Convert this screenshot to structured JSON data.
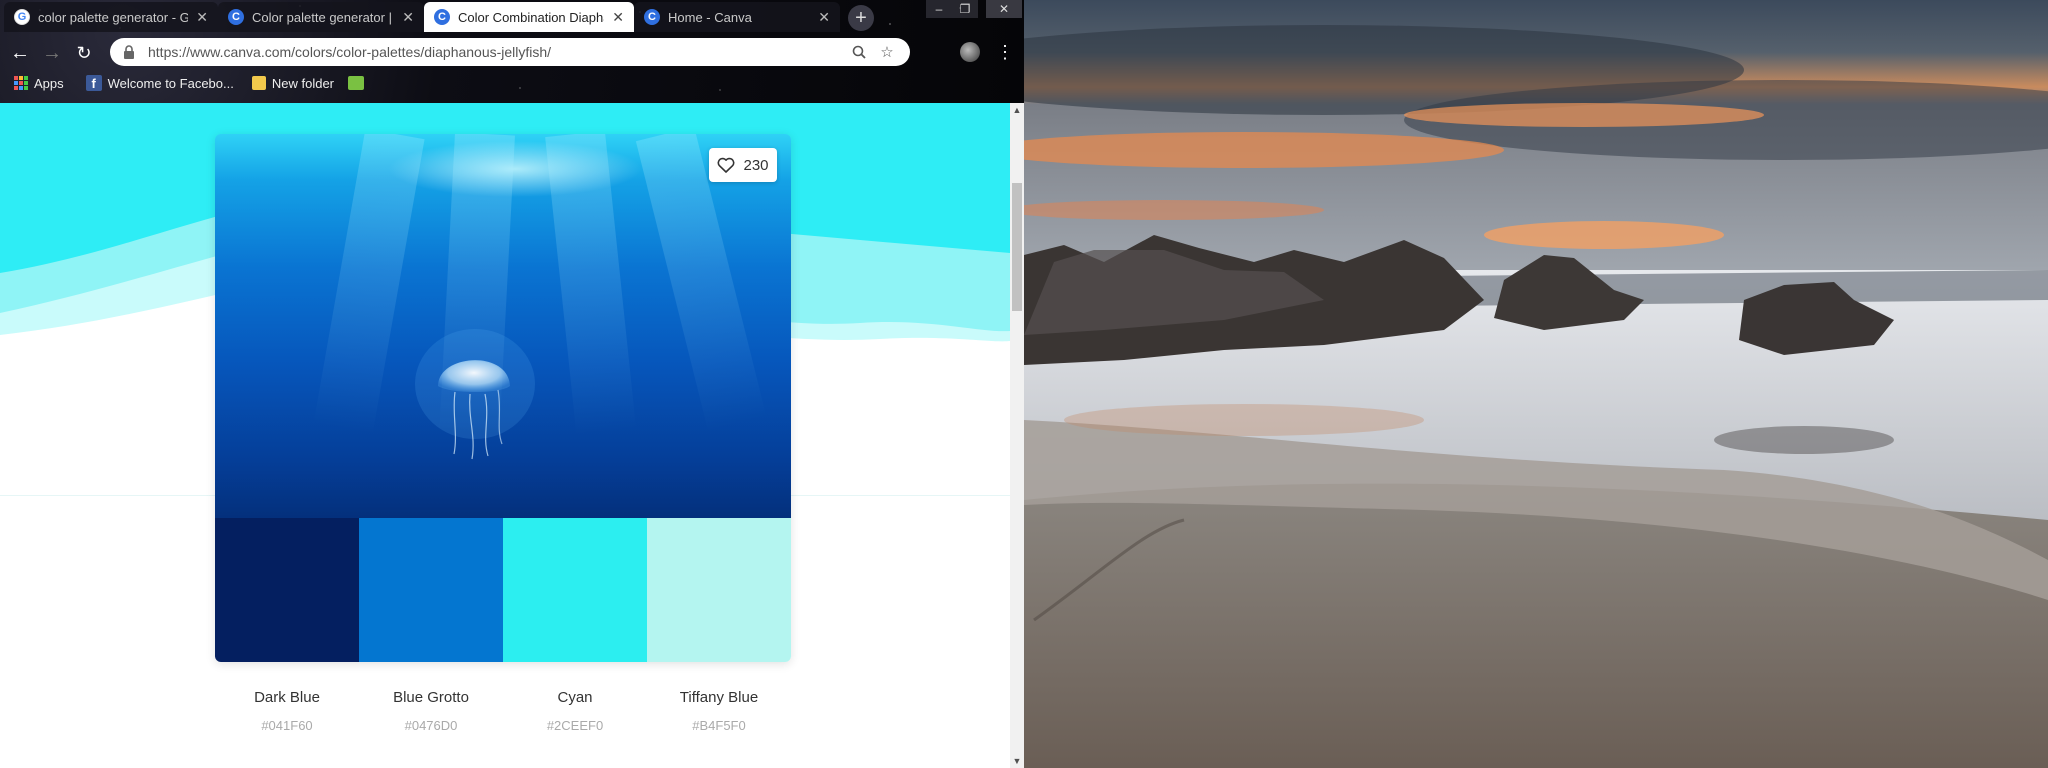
{
  "tabs": [
    {
      "title": "color palette generator - G",
      "favicon": "google-icon",
      "active": false
    },
    {
      "title": "Color palette generator | C",
      "favicon": "canva-icon",
      "active": false
    },
    {
      "title": "Color Combination Diapha",
      "favicon": "canva-icon",
      "active": true
    },
    {
      "title": "Home - Canva",
      "favicon": "canva-icon",
      "active": false
    }
  ],
  "address_bar": {
    "url": "https://www.canva.com/colors/color-palettes/diaphanous-jellyfish/"
  },
  "bookmarks": [
    {
      "label": "Apps",
      "icon": "apps-grid-icon"
    },
    {
      "label": "Welcome to Facebo...",
      "icon": "facebook-icon"
    },
    {
      "label": "New folder",
      "icon": "folder-icon"
    },
    {
      "label": "",
      "icon": "chart-icon"
    }
  ],
  "palette": {
    "likes": "230",
    "colors": [
      {
        "name": "Dark Blue",
        "hex": "#041F60"
      },
      {
        "name": "Blue Grotto",
        "hex": "#0476D0"
      },
      {
        "name": "Cyan",
        "hex": "#2CEEF0"
      },
      {
        "name": "Tiffany Blue",
        "hex": "#B4F5F0"
      }
    ]
  }
}
